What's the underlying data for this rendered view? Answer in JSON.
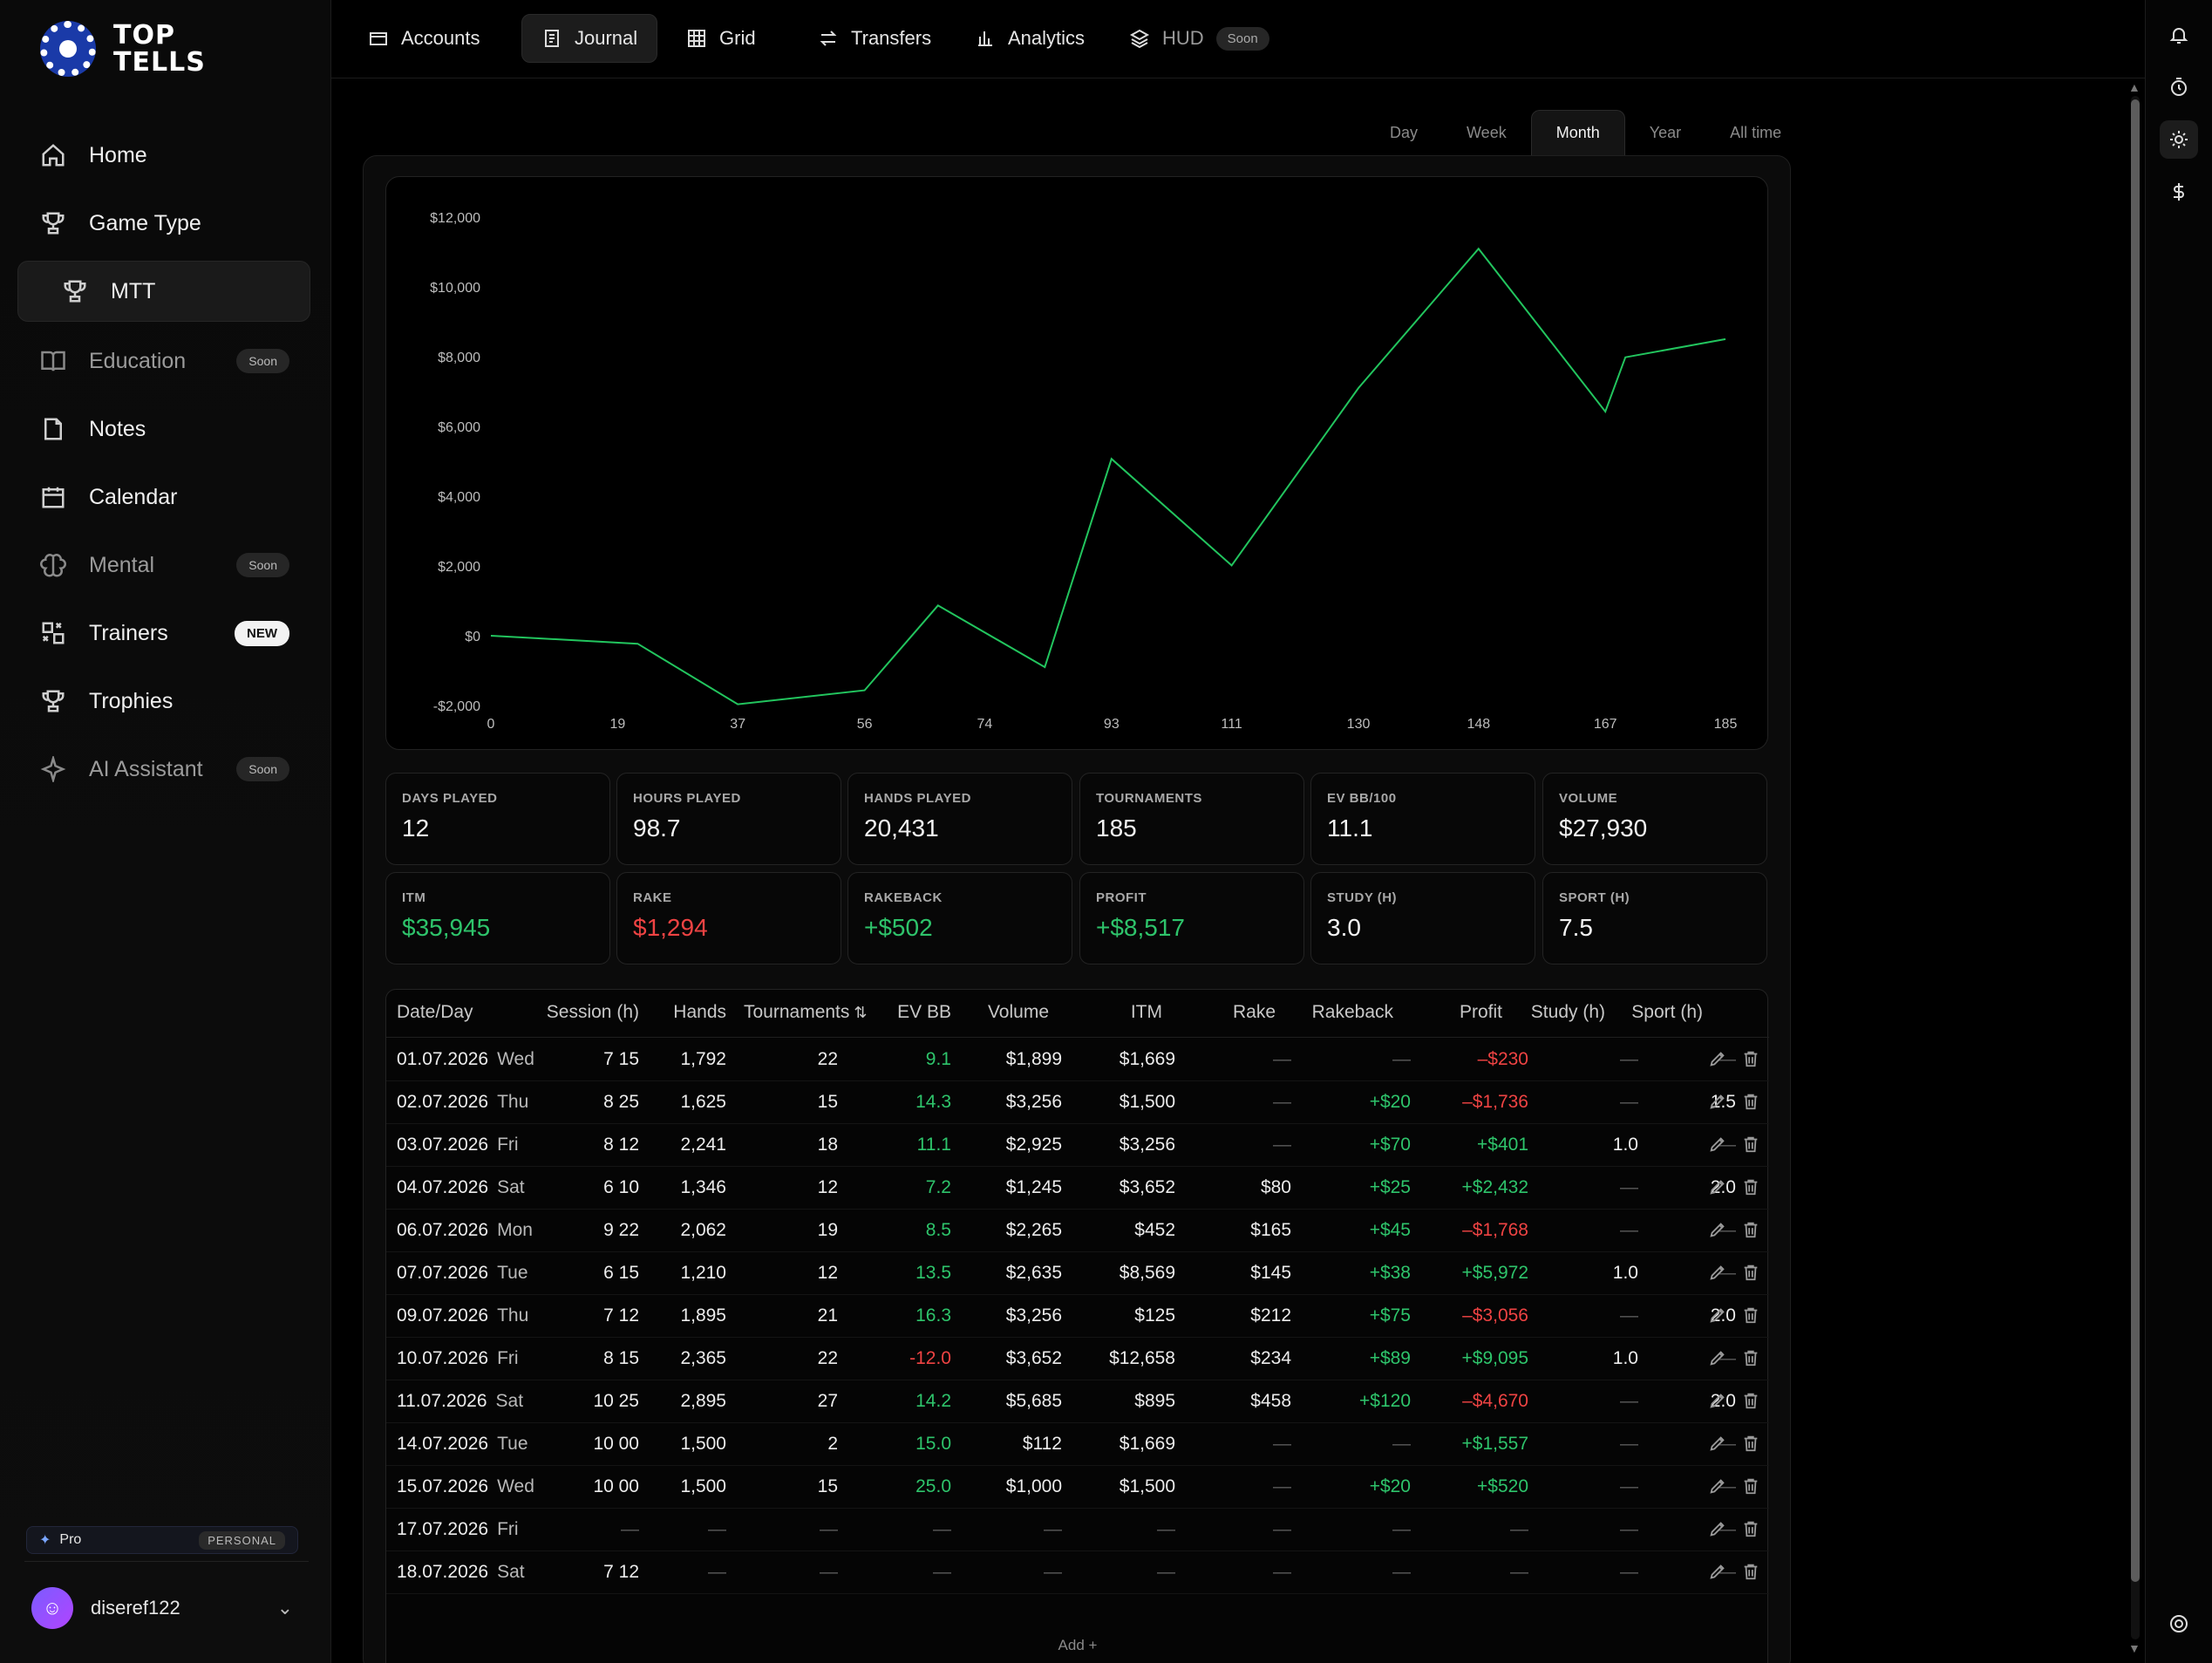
{
  "brand": {
    "line1": "TOP",
    "line2": "TELLS"
  },
  "sidebar": {
    "items": [
      {
        "label": "Home",
        "icon": "home-icon"
      },
      {
        "label": "Game Type",
        "icon": "trophy-icon"
      },
      {
        "label": "MTT",
        "icon": "trophy-icon"
      },
      {
        "label": "Education",
        "icon": "book-icon",
        "badge": "Soon"
      },
      {
        "label": "Notes",
        "icon": "note-icon"
      },
      {
        "label": "Calendar",
        "icon": "calendar-icon"
      },
      {
        "label": "Mental",
        "icon": "brain-icon",
        "badge": "Soon"
      },
      {
        "label": "Trainers",
        "icon": "trainers-icon",
        "badge": "NEW"
      },
      {
        "label": "Trophies",
        "icon": "trophy-icon"
      },
      {
        "label": "AI Assistant",
        "icon": "sparkle-icon",
        "badge": "Soon"
      }
    ],
    "plan": {
      "name": "Pro",
      "tag": "PERSONAL"
    },
    "user": {
      "name": "diseref122"
    }
  },
  "topnav": {
    "tabs": [
      {
        "label": "Accounts",
        "icon": "wallet-icon"
      },
      {
        "label": "Journal",
        "icon": "journal-icon"
      },
      {
        "label": "Grid",
        "icon": "grid-icon"
      },
      {
        "label": "Transfers",
        "icon": "transfer-icon"
      },
      {
        "label": "Analytics",
        "icon": "bar-chart-icon"
      },
      {
        "label": "HUD",
        "icon": "layers-icon",
        "badge": "Soon"
      }
    ],
    "active": "Journal"
  },
  "periods": {
    "items": [
      "Day",
      "Week",
      "Month",
      "Year",
      "All time"
    ],
    "active": "Month"
  },
  "chart_data": {
    "type": "line",
    "title": "",
    "xlabel": "",
    "ylabel": "",
    "x_ticks": [
      "0",
      "19",
      "37",
      "56",
      "74",
      "93",
      "111",
      "130",
      "148",
      "167",
      "185"
    ],
    "y_ticks": [
      "$12,000",
      "$10,000",
      "$8,000",
      "$6,000",
      "$4,000",
      "$2,000",
      "$0",
      "-$2,000"
    ],
    "ylim": [
      -2000,
      12000
    ],
    "xlim": [
      0,
      185
    ],
    "series": [
      {
        "color": "#22c55e",
        "points": [
          [
            0,
            0
          ],
          [
            22,
            -230
          ],
          [
            37,
            -1966
          ],
          [
            56,
            -1565
          ],
          [
            67,
            867
          ],
          [
            83,
            -901
          ],
          [
            93,
            5071
          ],
          [
            111,
            2015
          ],
          [
            130,
            7100
          ],
          [
            148,
            11095
          ],
          [
            167,
            6425
          ],
          [
            170,
            7982
          ],
          [
            185,
            8502
          ]
        ]
      }
    ],
    "grid": false
  },
  "stats": [
    {
      "label": "DAYS PLAYED",
      "value": "12"
    },
    {
      "label": "HOURS PLAYED",
      "value": "98.7"
    },
    {
      "label": "HANDS PLAYED",
      "value": "20,431"
    },
    {
      "label": "TOURNAMENTS",
      "value": "185"
    },
    {
      "label": "EV BB/100",
      "value": "11.1"
    },
    {
      "label": "VOLUME",
      "value": "$27,930"
    },
    {
      "label": "ITM",
      "value": "$35,945",
      "tone": "green"
    },
    {
      "label": "RAKE",
      "value": "$1,294",
      "tone": "red"
    },
    {
      "label": "RAKEBACK",
      "value": "+$502",
      "tone": "green"
    },
    {
      "label": "PROFIT",
      "value": "+$8,517",
      "tone": "green"
    },
    {
      "label": "STUDY (H)",
      "value": "3.0"
    },
    {
      "label": "SPORT (H)",
      "value": "7.5"
    }
  ],
  "table": {
    "headers": [
      "Date/Day",
      "Session (h)",
      "Hands",
      "Tournaments",
      "EV BB",
      "Volume",
      "ITM",
      "Rake",
      "Rakeback",
      "Profit",
      "Study (h)",
      "Sport (h)"
    ],
    "sort_icon": "sort-icon",
    "rows": [
      {
        "date": "01.07.2026",
        "day": "Wed",
        "session": "7 15",
        "hands": "1,792",
        "tournaments": "22",
        "ev": "9.1",
        "ev_tone": "green",
        "volume": "$1,899",
        "itm": "$1,669",
        "rake": "—",
        "rakeback": "—",
        "profit": "–$230",
        "profit_tone": "red",
        "study": "—",
        "sport": "—"
      },
      {
        "date": "02.07.2026",
        "day": "Thu",
        "session": "8 25",
        "hands": "1,625",
        "tournaments": "15",
        "ev": "14.3",
        "ev_tone": "green",
        "volume": "$3,256",
        "itm": "$1,500",
        "rake": "—",
        "rakeback": "+$20",
        "profit": "–$1,736",
        "profit_tone": "red",
        "study": "—",
        "sport": "1.5"
      },
      {
        "date": "03.07.2026",
        "day": "Fri",
        "session": "8 12",
        "hands": "2,241",
        "tournaments": "18",
        "ev": "11.1",
        "ev_tone": "green",
        "volume": "$2,925",
        "itm": "$3,256",
        "rake": "—",
        "rakeback": "+$70",
        "profit": "+$401",
        "profit_tone": "green",
        "study": "1.0",
        "sport": "—"
      },
      {
        "date": "04.07.2026",
        "day": "Sat",
        "session": "6 10",
        "hands": "1,346",
        "tournaments": "12",
        "ev": "7.2",
        "ev_tone": "green",
        "volume": "$1,245",
        "itm": "$3,652",
        "rake": "$80",
        "rakeback": "+$25",
        "profit": "+$2,432",
        "profit_tone": "green",
        "study": "—",
        "sport": "2.0"
      },
      {
        "date": "06.07.2026",
        "day": "Mon",
        "session": "9 22",
        "hands": "2,062",
        "tournaments": "19",
        "ev": "8.5",
        "ev_tone": "green",
        "volume": "$2,265",
        "itm": "$452",
        "rake": "$165",
        "rakeback": "+$45",
        "profit": "–$1,768",
        "profit_tone": "red",
        "study": "—",
        "sport": "—"
      },
      {
        "date": "07.07.2026",
        "day": "Tue",
        "session": "6 15",
        "hands": "1,210",
        "tournaments": "12",
        "ev": "13.5",
        "ev_tone": "green",
        "volume": "$2,635",
        "itm": "$8,569",
        "rake": "$145",
        "rakeback": "+$38",
        "profit": "+$5,972",
        "profit_tone": "green",
        "study": "1.0",
        "sport": "—"
      },
      {
        "date": "09.07.2026",
        "day": "Thu",
        "session": "7 12",
        "hands": "1,895",
        "tournaments": "21",
        "ev": "16.3",
        "ev_tone": "green",
        "volume": "$3,256",
        "itm": "$125",
        "rake": "$212",
        "rakeback": "+$75",
        "profit": "–$3,056",
        "profit_tone": "red",
        "study": "—",
        "sport": "2.0"
      },
      {
        "date": "10.07.2026",
        "day": "Fri",
        "session": "8 15",
        "hands": "2,365",
        "tournaments": "22",
        "ev": "-12.0",
        "ev_tone": "red",
        "volume": "$3,652",
        "itm": "$12,658",
        "rake": "$234",
        "rakeback": "+$89",
        "profit": "+$9,095",
        "profit_tone": "green",
        "study": "1.0",
        "sport": "—"
      },
      {
        "date": "11.07.2026",
        "day": "Sat",
        "session": "10 25",
        "hands": "2,895",
        "tournaments": "27",
        "ev": "14.2",
        "ev_tone": "green",
        "volume": "$5,685",
        "itm": "$895",
        "rake": "$458",
        "rakeback": "+$120",
        "profit": "–$4,670",
        "profit_tone": "red",
        "study": "—",
        "sport": "2.0"
      },
      {
        "date": "14.07.2026",
        "day": "Tue",
        "session": "10 00",
        "hands": "1,500",
        "tournaments": "2",
        "ev": "15.0",
        "ev_tone": "green",
        "volume": "$112",
        "itm": "$1,669",
        "rake": "—",
        "rakeback": "—",
        "profit": "+$1,557",
        "profit_tone": "green",
        "study": "—",
        "sport": "—"
      },
      {
        "date": "15.07.2026",
        "day": "Wed",
        "session": "10 00",
        "hands": "1,500",
        "tournaments": "15",
        "ev": "25.0",
        "ev_tone": "green",
        "volume": "$1,000",
        "itm": "$1,500",
        "rake": "—",
        "rakeback": "+$20",
        "profit": "+$520",
        "profit_tone": "green",
        "study": "—",
        "sport": "—"
      },
      {
        "date": "17.07.2026",
        "day": "Fri",
        "session": "—",
        "hands": "—",
        "tournaments": "—",
        "ev": "—",
        "ev_tone": "",
        "volume": "—",
        "itm": "—",
        "rake": "—",
        "rakeback": "—",
        "profit": "—",
        "profit_tone": "",
        "study": "—",
        "sport": "—"
      },
      {
        "date": "18.07.2026",
        "day": "Sat",
        "session": "7 12",
        "hands": "—",
        "tournaments": "—",
        "ev": "—",
        "ev_tone": "",
        "volume": "—",
        "itm": "—",
        "rake": "—",
        "rakeback": "—",
        "profit": "—",
        "profit_tone": "",
        "study": "—",
        "sport": "—"
      }
    ],
    "add_label": "Add +"
  },
  "colors": {
    "accent_green": "#22c55e",
    "negative_red": "#ef4343",
    "background": "#000000"
  }
}
